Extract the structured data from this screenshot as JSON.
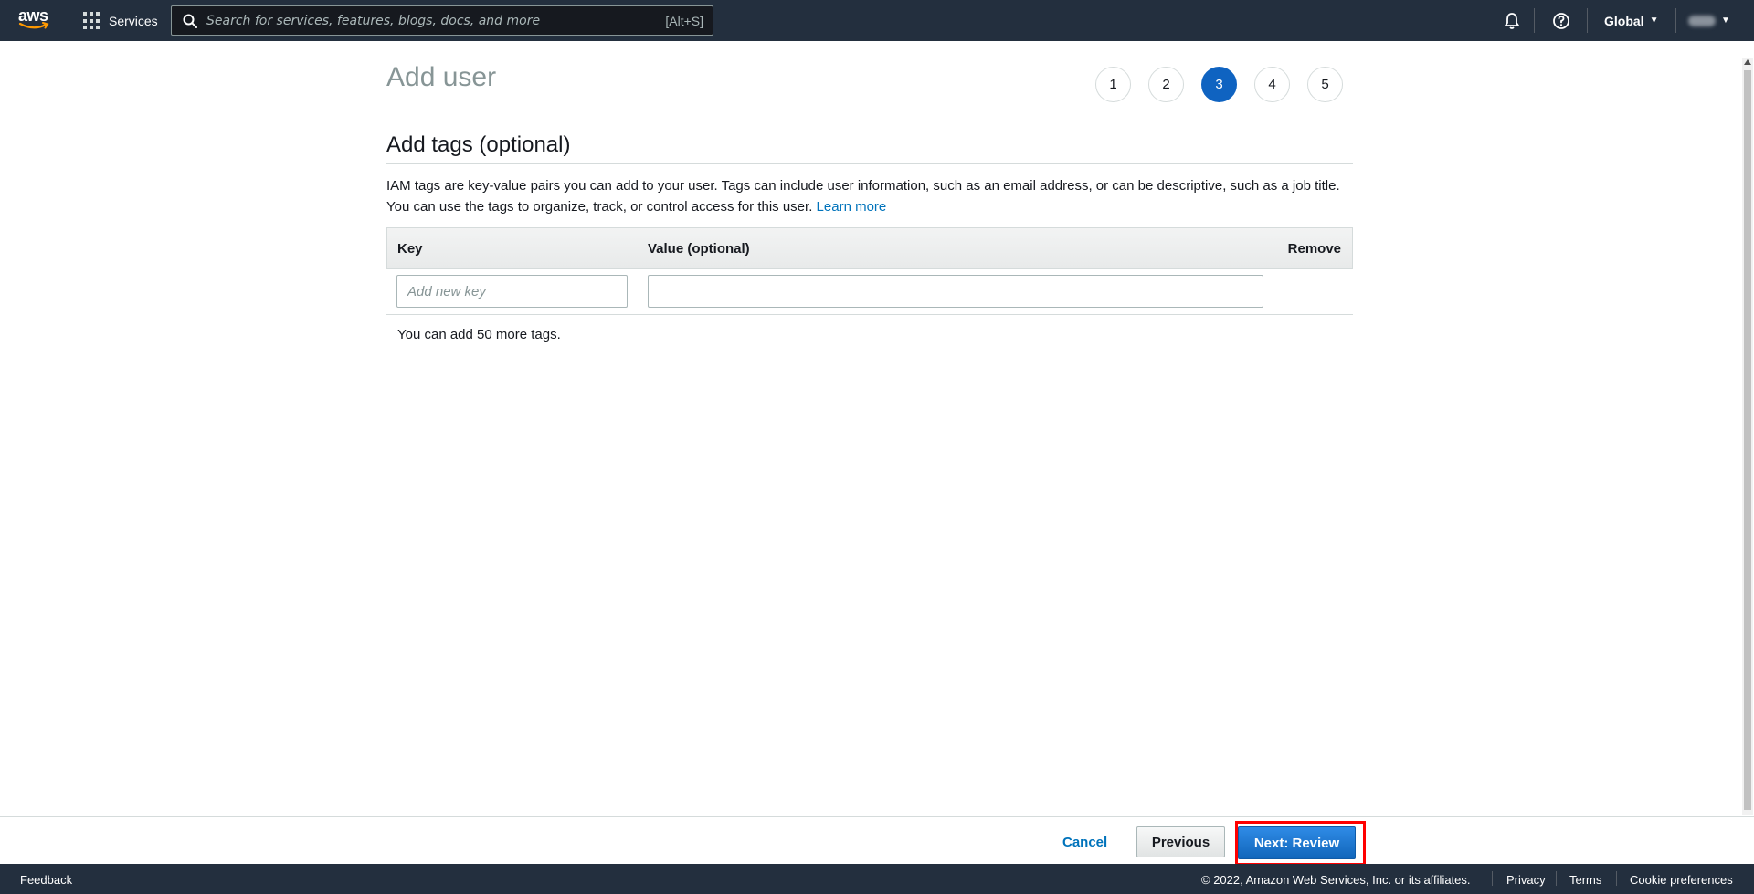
{
  "topnav": {
    "logo_text": "aws",
    "services_label": "Services",
    "search_placeholder": "Search for services, features, blogs, docs, and more",
    "search_shortcut": "[Alt+S]",
    "region_label": "Global",
    "icons": [
      "aws-logo",
      "grid-icon",
      "search-icon",
      "bell-icon",
      "help-icon",
      "caret-down-icon"
    ]
  },
  "page": {
    "title": "Add user",
    "steps": [
      "1",
      "2",
      "3",
      "4",
      "5"
    ],
    "active_step": "3"
  },
  "section": {
    "title": "Add tags (optional)",
    "description": "IAM tags are key-value pairs you can add to your user. Tags can include user information, such as an email address, or can be descriptive, such as a job title. You can use the tags to organize, track, or control access for this user.",
    "learn_more": "Learn more"
  },
  "tags_table": {
    "headers": {
      "key": "Key",
      "value": "Value (optional)",
      "remove": "Remove"
    },
    "key_placeholder": "Add new key",
    "value_current": "",
    "remaining_text": "You can add 50 more tags."
  },
  "actions": {
    "cancel": "Cancel",
    "previous": "Previous",
    "next": "Next: Review"
  },
  "footer": {
    "feedback": "Feedback",
    "copyright": "© 2022, Amazon Web Services, Inc. or its affiliates.",
    "privacy": "Privacy",
    "terms": "Terms",
    "cookies": "Cookie preferences"
  },
  "colors": {
    "nav_bg": "#232f3e",
    "active_step": "#0f63c1",
    "link": "#0073bb",
    "primary_button": "#1166bb",
    "highlight": "#ff0000"
  }
}
